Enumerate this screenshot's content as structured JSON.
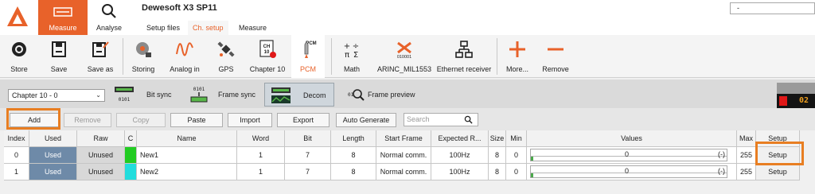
{
  "app": {
    "title": "Dewesoft X3 SP11",
    "title_box": "-",
    "modes": [
      {
        "label": "Measure",
        "icon": "measure-icon",
        "active": true
      },
      {
        "label": "Analyse",
        "icon": "search-icon",
        "active": false
      }
    ],
    "subtabs": [
      "Setup files",
      "Ch. setup",
      "Measure"
    ]
  },
  "ribbon": {
    "items": [
      {
        "label": "Store",
        "icon": "record-icon"
      },
      {
        "label": "Save",
        "icon": "save-icon"
      },
      {
        "label": "Save as",
        "icon": "save-as-icon"
      },
      {
        "label": "Storing",
        "icon": "storing-icon"
      },
      {
        "label": "Analog in",
        "icon": "analog-in-icon"
      },
      {
        "label": "GPS",
        "icon": "gps-icon"
      },
      {
        "label": "Chapter 10",
        "icon": "chapter10-icon",
        "icon_text": "CH 10"
      },
      {
        "label": "PCM",
        "icon": "pcm-icon",
        "icon_text": "PCM",
        "active": true
      },
      {
        "label": "Math",
        "icon": "math-icon"
      },
      {
        "label": "ARINC_MIL1553",
        "icon": "arinc-icon",
        "icon_text": "010001"
      },
      {
        "label": "Ethernet receiver",
        "icon": "ethernet-icon"
      },
      {
        "label": "More...",
        "icon": "plus-icon"
      },
      {
        "label": "Remove",
        "icon": "minus-icon"
      }
    ]
  },
  "subbar": {
    "chapter_select": "Chapter 10 - 0",
    "tabs": [
      "Bit sync",
      "Frame sync",
      "Decom",
      "Frame preview"
    ],
    "active_tab": "Decom",
    "time_fragment": "02"
  },
  "toolbar": {
    "buttons": [
      {
        "label": "Add",
        "enabled": true
      },
      {
        "label": "Remove",
        "enabled": false
      },
      {
        "label": "Copy",
        "enabled": false
      },
      {
        "label": "Paste",
        "enabled": true
      },
      {
        "label": "Import",
        "enabled": true
      },
      {
        "label": "Export",
        "enabled": true
      },
      {
        "label": "Auto Generate",
        "enabled": true
      }
    ],
    "search_placeholder": "Search"
  },
  "table": {
    "headers": [
      "Index",
      "Used",
      "Raw",
      "C",
      "Name",
      "Word",
      "Bit",
      "Length",
      "Start Frame",
      "Expected R...",
      "Size",
      "Min",
      "Values",
      "Max",
      "Setup"
    ],
    "rows": [
      {
        "index": "0",
        "used": "Used",
        "raw": "Unused",
        "color": "#22cc22",
        "name": "New1",
        "word": "1",
        "bit": "7",
        "length": "8",
        "start_frame": "Normal comm.",
        "expected_rate": "100Hz",
        "size": "8",
        "min": "0",
        "value": "0",
        "value_unit": "(-)",
        "max": "255",
        "setup": "Setup"
      },
      {
        "index": "1",
        "used": "Used",
        "raw": "Unused",
        "color": "#22dddd",
        "name": "New2",
        "word": "1",
        "bit": "7",
        "length": "8",
        "start_frame": "Normal comm.",
        "expected_rate": "100Hz",
        "size": "8",
        "min": "0",
        "value": "0",
        "value_unit": "(-)",
        "max": "255",
        "setup": "Setup"
      }
    ]
  },
  "colors": {
    "accent": "#e8622a",
    "highlight": "#e87e22",
    "used_cell": "#6e8aa8"
  }
}
